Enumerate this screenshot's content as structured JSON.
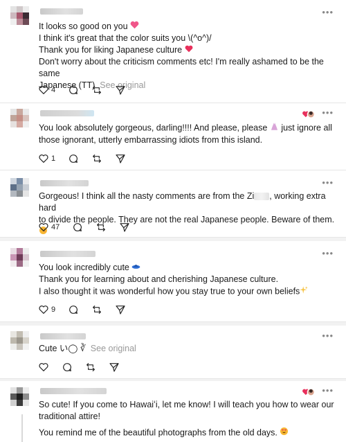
{
  "comments": [
    {
      "lines": [
        "It looks so good on you",
        "I think it's great that the color suits you \\(^o^)/",
        "Thank you for liking Japanese culture",
        "Don't worry about the criticism comments etc! I'm really ashamed to be the same",
        "Japanese (TT)"
      ],
      "see_original": "See original",
      "likes": "4"
    },
    {
      "lines": [
        "You look absolutely gorgeous, darling!!!! And please, please",
        "just ignore all",
        "those ignorant, utterly embarrassing idiots from this island."
      ],
      "likes": "1"
    },
    {
      "lines": [
        "Gorgeous! I think all the nasty comments are from the Zi",
        ", working extra hard",
        "to divide the people. They are not the real Japanese people. Beware of them."
      ],
      "likes": "47"
    },
    {
      "lines": [
        "You look incredibly cute",
        "Thank you for learning about and cherishing Japanese culture.",
        "I also thought it was wonderful how you stay true to your own beliefs"
      ],
      "likes": "9"
    },
    {
      "lines": [
        "Cute",
        "い◯ ∛"
      ],
      "see_original": "See original",
      "likes": ""
    },
    {
      "lines": [
        "So cute! If you come to Hawaiʻi, let me know! I will teach you how to wear our",
        "traditional attire!",
        "You remind me of the beautiful photographs from the old days."
      ]
    }
  ],
  "icons": [
    "heart-icon",
    "comment-icon",
    "repost-icon",
    "share-icon",
    "more-icon"
  ],
  "colors": {
    "heart": "#e8305c",
    "text": "#1a1a1a",
    "muted": "#999999"
  }
}
